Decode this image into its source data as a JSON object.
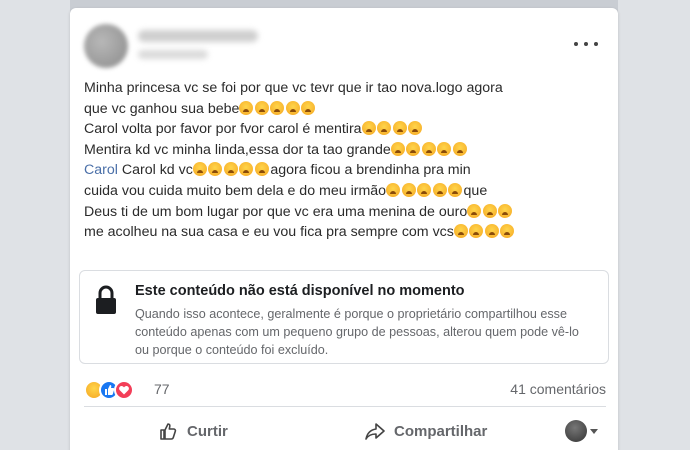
{
  "post": {
    "lines": [
      "Minha princesa vc se foi por que vc tevr que ir tao nova.logo agora",
      "que vc ganhou sua bebe",
      "Carol volta por favor por fvor carol é mentira",
      "Mentira kd vc minha linda,essa dor ta tao grande",
      "Carol",
      " Carol kd vc",
      "agora ficou a brendinha pra min",
      "cuida vou cuida muito bem dela e do meu irmão",
      "que",
      "Deus ti de um bom lugar por que vc era uma menina de ouro",
      "me acolheu na sua casa e eu vou fica pra sempre com vcs"
    ],
    "emoji_name": "crying-face-emoji"
  },
  "unavailable": {
    "title": "Este conteúdo não está disponível no momento",
    "body": "Quando isso acontece, geralmente é porque o proprietário compartilhou esse conteúdo apenas com um pequeno grupo de pessoas, alterou quem pode vê-lo ou porque o conteúdo foi excluído."
  },
  "stats": {
    "reactions_count": "77",
    "comments": "41 comentários",
    "reaction_icons": [
      "sad-reaction-icon",
      "like-reaction-icon",
      "love-reaction-icon"
    ]
  },
  "actions": {
    "like": "Curtir",
    "share": "Compartilhar"
  },
  "colors": {
    "mention": "#4a6fa8",
    "like_blue": "#1877f2",
    "love_red": "#f33e58",
    "muted_text": "#65676b"
  }
}
